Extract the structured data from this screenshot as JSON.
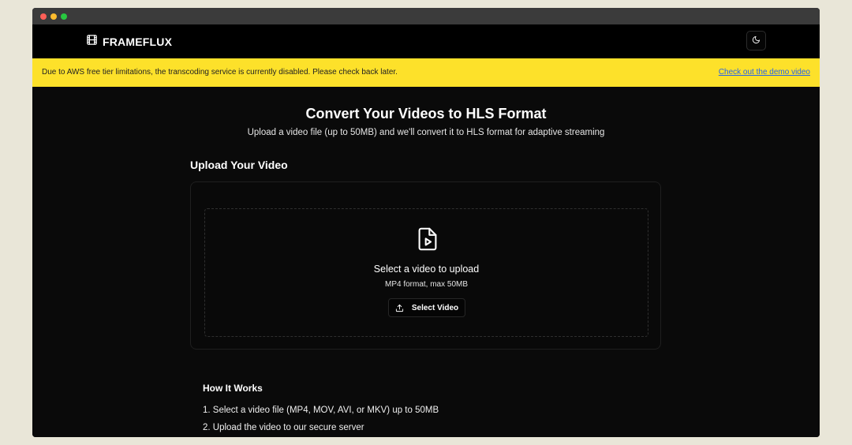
{
  "app": {
    "name": "FRAMEFLUX",
    "icons": {
      "logo": "film-icon",
      "theme": "moon-icon"
    }
  },
  "banner": {
    "message": "Due to AWS free tier limitations, the transcoding service is currently disabled. Please check back later.",
    "link_text": "Check out the demo video",
    "bg_color": "#fde12a",
    "link_color": "#2563eb"
  },
  "hero": {
    "title": "Convert Your Videos to HLS Format",
    "subtitle": "Upload a video file (up to 50MB) and we'll convert it to HLS format for adaptive streaming"
  },
  "upload": {
    "section_title": "Upload Your Video",
    "icon": "file-video-icon",
    "title": "Select a video to upload",
    "hint": "MP4 format, max 50MB",
    "button_label": "Select Video",
    "button_icon": "upload-icon"
  },
  "how_it_works": {
    "title": "How It Works",
    "steps": [
      "1. Select a video file (MP4, MOV, AVI, or MKV) up to 50MB",
      "2. Upload the video to our secure server"
    ]
  }
}
